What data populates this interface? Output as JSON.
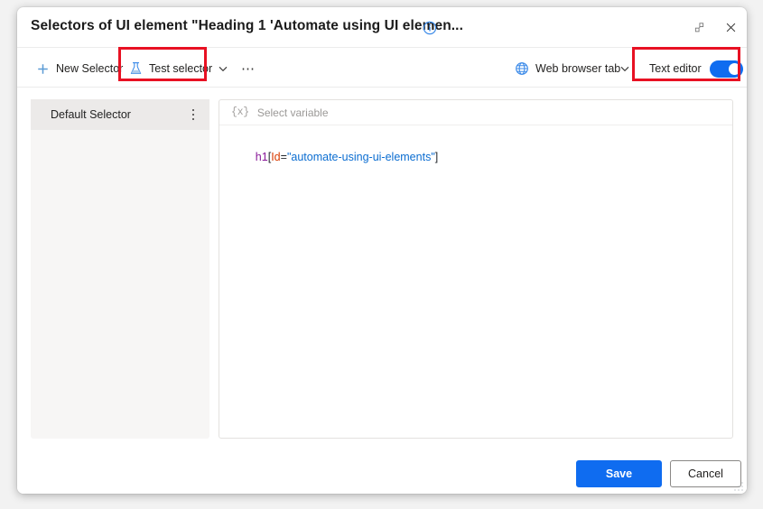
{
  "window": {
    "title": "Selectors of UI element \"Heading 1 'Automate using UI elemen...",
    "info_icon": "info-circle-icon",
    "expand_icon": "expand-diagonal-icon",
    "close_icon": "close-x-icon"
  },
  "toolbar": {
    "new_selector": {
      "label": "New Selector",
      "icon": "plus-icon"
    },
    "test_selector": {
      "label": "Test selector",
      "icon": "flask-icon",
      "highlighted": true
    },
    "test_caret": "chevron-down-icon",
    "overflow": "ellipsis-horizontal-icon",
    "web_browser_tab": {
      "label": "Web browser tab",
      "icon": "globe-icon"
    },
    "web_caret": "chevron-down-icon",
    "text_editor": {
      "label": "Text editor",
      "toggle_on": true,
      "highlighted": true
    }
  },
  "selector_list": {
    "items": [
      {
        "label": "Default Selector",
        "selected": true,
        "menu_icon": "more-vertical-icon"
      }
    ]
  },
  "editor": {
    "variable_bar": {
      "glyph": "{x}",
      "placeholder": "Select variable"
    },
    "code_tokens": [
      {
        "text": "h1",
        "type": "tag"
      },
      {
        "text": "[",
        "type": "punct"
      },
      {
        "text": "Id",
        "type": "attr"
      },
      {
        "text": "=",
        "type": "eq"
      },
      {
        "text": "\"automate-using-ui-elements\"",
        "type": "string"
      },
      {
        "text": "]",
        "type": "punct"
      }
    ],
    "code_plain": "h1[Id=\"automate-using-ui-elements\"]"
  },
  "footer": {
    "save_label": "Save",
    "cancel_label": "Cancel"
  },
  "colors": {
    "accent_blue": "#0f6cf0",
    "highlight_red": "#e81123",
    "icon_blue": "#5b9bd5",
    "token_tag": "#881798",
    "token_attr": "#d83b01",
    "token_string": "#0b6dd1"
  }
}
